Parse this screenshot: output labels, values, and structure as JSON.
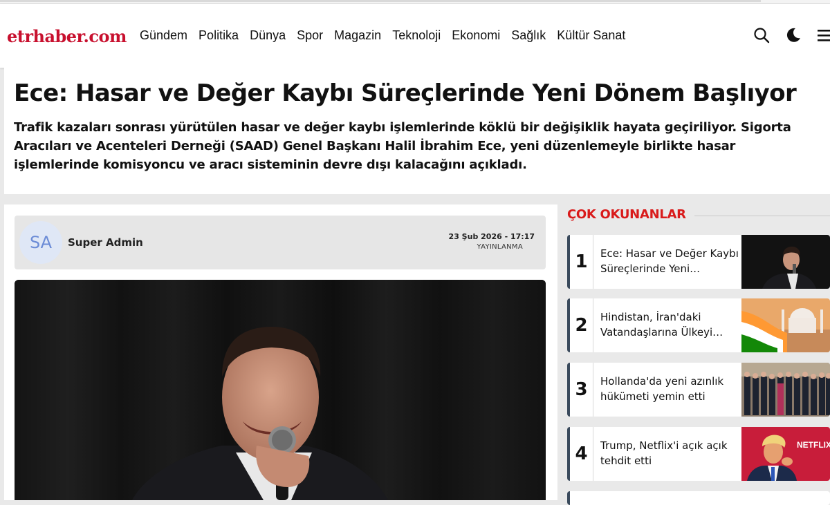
{
  "site": {
    "logo": "etrhaber.com"
  },
  "nav": {
    "items": [
      "Gündem",
      "Politika",
      "Dünya",
      "Spor",
      "Magazin",
      "Teknoloji",
      "Ekonomi",
      "Sağlık",
      "Kültür Sanat"
    ]
  },
  "article": {
    "title": "Ece: Hasar ve Değer Kaybı Süreçlerinde Yeni Dönem Başlıyor",
    "summary": "Trafik kazaları sonrası yürütülen hasar ve değer kaybı işlemlerinde köklü bir değişiklik hayata geçiriliyor. Sigorta Aracıları ve Acenteleri Derneği (SAAD) Genel Başkanı Halil İbrahim Ece, yeni düzenlemeyle birlikte hasar işlemlerinde komisyoncu ve aracı sisteminin devre dışı kalacağını açıkladı.",
    "author_initials": "SA",
    "author_name": "Super Admin",
    "published_date": "23 Şub 2026 - 17:17",
    "published_label": "YAYINLANMA"
  },
  "sidebar": {
    "title": "ÇOK OKUNANLAR",
    "items": [
      {
        "num": "1",
        "title": "Ece: Hasar ve Değer Kaybı Süreçlerinde Yeni…"
      },
      {
        "num": "2",
        "title": "Hindistan, İran'daki Vatandaşlarına Ülkeyi…"
      },
      {
        "num": "3",
        "title": "Hollanda'da yeni azınlık hükümeti yemin etti"
      },
      {
        "num": "4",
        "title": "Trump, Netflix'i açık açık tehdit etti"
      }
    ]
  },
  "thumb_texts": {
    "netflix": "NETFLIX"
  },
  "colors": {
    "brand": "#c8102e",
    "section_title": "#d91a1a",
    "card_accent": "#3a4a5c"
  },
  "icons": [
    "search-icon",
    "moon-icon",
    "hamburger-menu-icon"
  ]
}
